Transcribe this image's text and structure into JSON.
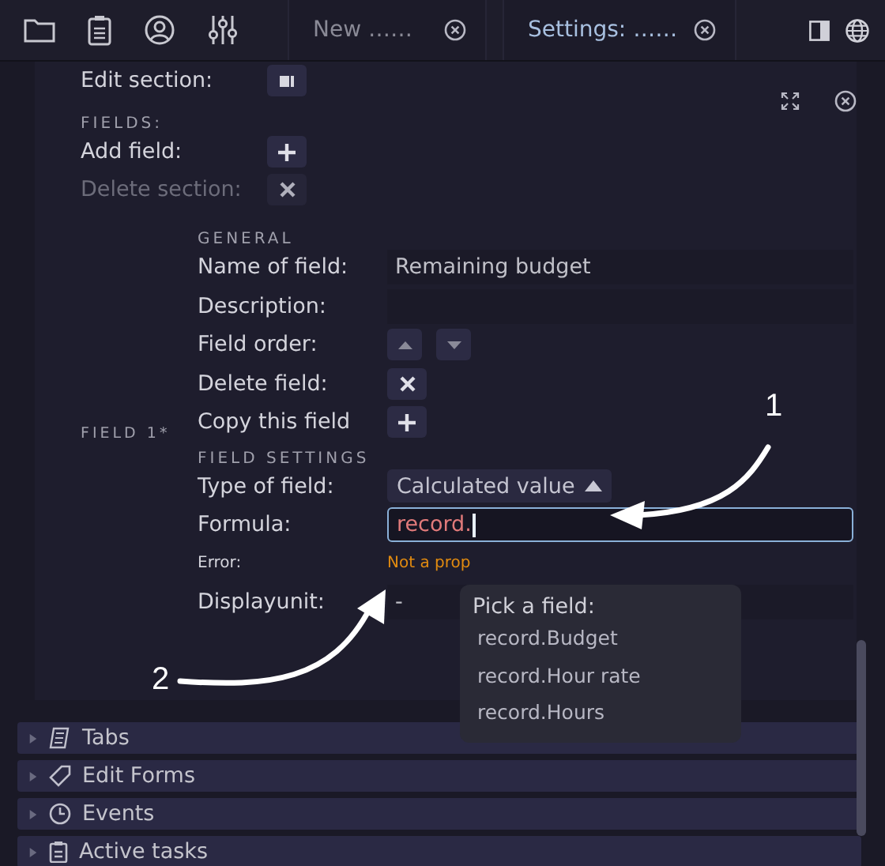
{
  "toolbar": {
    "tabs": [
      {
        "label": "New ……",
        "selected": false
      },
      {
        "label": "Settings: ……",
        "selected": true
      }
    ]
  },
  "section": {
    "edit_label": "Edit section:",
    "fields_heading": "FIELDS:",
    "add_field": "Add field:",
    "delete_section": {
      "label": "Delete section:",
      "disabled": true
    }
  },
  "field": {
    "label": "FIELD 1*",
    "general_heading": "GENERAL",
    "name": {
      "label": "Name of field:",
      "value": "Remaining budget"
    },
    "description": {
      "label": "Description:"
    },
    "order": {
      "label": "Field order:"
    },
    "delete": {
      "label": "Delete field:"
    },
    "copy": {
      "label": "Copy this field"
    },
    "settings_heading": "FIELD SETTINGS",
    "type": {
      "label": "Type of field:",
      "value": "Calculated value",
      "expanded": true
    },
    "formula": {
      "label": "Formula:",
      "value": "record."
    },
    "error": {
      "label": "Error:",
      "value": "Not a prop"
    },
    "displayunit": {
      "label": "Displayunit:",
      "value": "-"
    }
  },
  "popup": {
    "title": "Pick a field:",
    "items": [
      "record.Budget",
      "record.Hour rate",
      "record.Hours"
    ]
  },
  "accordion": [
    {
      "label": "Tabs",
      "expanded": false
    },
    {
      "label": "Edit Forms",
      "expanded": false
    },
    {
      "label": "Events",
      "expanded": false
    },
    {
      "label": "Active tasks",
      "expanded": false
    }
  ],
  "annotations": [
    {
      "label": "1"
    },
    {
      "label": "2"
    }
  ]
}
